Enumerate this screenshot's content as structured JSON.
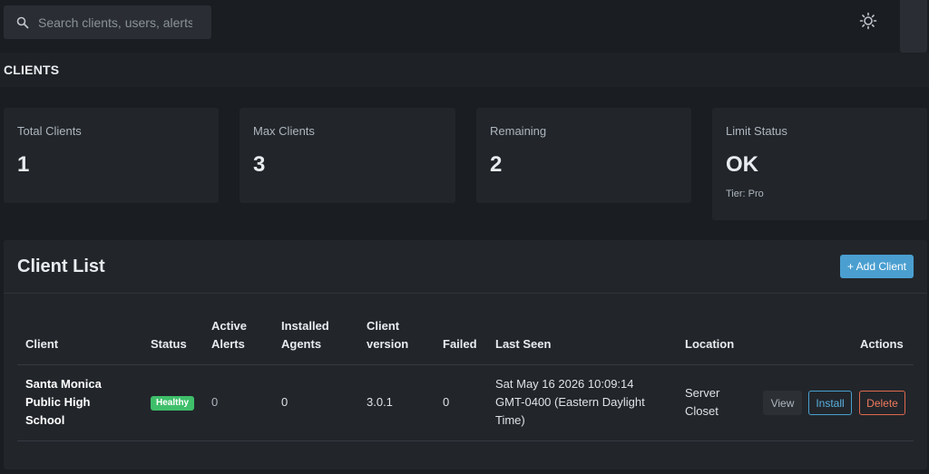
{
  "search": {
    "placeholder": "Search clients, users, alerts"
  },
  "page": {
    "title": "CLIENTS"
  },
  "stats": [
    {
      "label": "Total Clients",
      "value": "1"
    },
    {
      "label": "Max Clients",
      "value": "3"
    },
    {
      "label": "Remaining",
      "value": "2"
    },
    {
      "label": "Limit Status",
      "value": "OK",
      "sub": "Tier: Pro"
    }
  ],
  "client_list": {
    "title": "Client List",
    "add_label": "+ Add Client",
    "columns": {
      "client": "Client",
      "status": "Status",
      "active_alerts_1": "Active",
      "active_alerts_2": "Alerts",
      "installed_agents_1": "Installed",
      "installed_agents_2": "Agents",
      "client_version_1": "Client",
      "client_version_2": "version",
      "failed": "Failed",
      "last_seen": "Last Seen",
      "location": "Location",
      "actions": "Actions"
    },
    "rows": [
      {
        "client_1": "Santa Monica",
        "client_2": "Public High",
        "client_3": "School",
        "status": "Healthy",
        "active_alerts": "0",
        "installed_agents": "0",
        "client_version": "3.0.1",
        "failed": "0",
        "last_seen_1": "Sat May 16 2026 10:09:14",
        "last_seen_2": "GMT-0400 (Eastern Daylight",
        "last_seen_3": "Time)",
        "location_1": "Server",
        "location_2": "Closet",
        "actions": {
          "view": "View",
          "install": "Install",
          "delete": "Delete"
        }
      }
    ]
  },
  "colors": {
    "background": "#1a1d21",
    "card": "#22262b",
    "accent": "#4a9fd0",
    "healthy": "#3fbf6a",
    "danger": "#e0694d"
  }
}
